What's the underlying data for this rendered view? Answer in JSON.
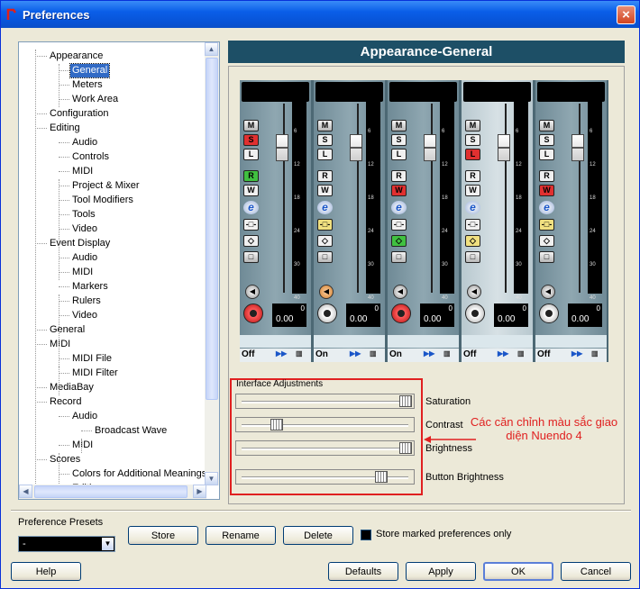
{
  "window": {
    "title": "Preferences",
    "close_icon": "×"
  },
  "tree": {
    "items": [
      {
        "label": "Appearance",
        "level": 1
      },
      {
        "label": "General",
        "level": 2,
        "selected": true
      },
      {
        "label": "Meters",
        "level": 2
      },
      {
        "label": "Work Area",
        "level": 2
      },
      {
        "label": "Configuration",
        "level": 1
      },
      {
        "label": "Editing",
        "level": 1
      },
      {
        "label": "Audio",
        "level": 2
      },
      {
        "label": "Controls",
        "level": 2
      },
      {
        "label": "MIDI",
        "level": 2
      },
      {
        "label": "Project & Mixer",
        "level": 2
      },
      {
        "label": "Tool Modifiers",
        "level": 2
      },
      {
        "label": "Tools",
        "level": 2
      },
      {
        "label": "Video",
        "level": 2
      },
      {
        "label": "Event Display",
        "level": 1
      },
      {
        "label": "Audio",
        "level": 2
      },
      {
        "label": "MIDI",
        "level": 2
      },
      {
        "label": "Markers",
        "level": 2
      },
      {
        "label": "Rulers",
        "level": 2
      },
      {
        "label": "Video",
        "level": 2
      },
      {
        "label": "General",
        "level": 1
      },
      {
        "label": "MIDI",
        "level": 1
      },
      {
        "label": "MIDI File",
        "level": 2
      },
      {
        "label": "MIDI Filter",
        "level": 2
      },
      {
        "label": "MediaBay",
        "level": 1
      },
      {
        "label": "Record",
        "level": 1
      },
      {
        "label": "Audio",
        "level": 2
      },
      {
        "label": "Broadcast Wave",
        "level": 3
      },
      {
        "label": "MIDI",
        "level": 2
      },
      {
        "label": "Scores",
        "level": 1
      },
      {
        "label": "Colors for Additional Meanings",
        "level": 2
      },
      {
        "label": "Editing",
        "level": 2
      }
    ]
  },
  "panel": {
    "title": "Appearance-General"
  },
  "mixer": {
    "buttons": {
      "mute": "M",
      "solo": "S",
      "listen": "L",
      "read": "R",
      "write": "W",
      "edit": "e"
    },
    "scale": [
      "6",
      "12",
      "18",
      "24",
      "30",
      "40"
    ],
    "channels": [
      {
        "value": "0.00",
        "peak": "0",
        "state": "Off",
        "solo_color": "#e03030",
        "listen_color": "#f0f0f0",
        "write_color": "#f0f0f0",
        "insert_color": "#f0f0f0",
        "send_color": "#f0f0f0",
        "rec_active": true,
        "mon_active": false,
        "read_active": true,
        "write_active": true
      },
      {
        "value": "0.00",
        "peak": "0",
        "state": "On",
        "solo_color": "#f0f0f0",
        "listen_color": "#f0f0f0",
        "write_color": "#f0f0f0",
        "insert_color": "#f0e080",
        "send_color": "#f0f0f0",
        "rec_active": false,
        "mon_active": true,
        "read_active": false,
        "write_active": false
      },
      {
        "value": "0.00",
        "peak": "0",
        "state": "On",
        "solo_color": "#f0f0f0",
        "listen_color": "#f0f0f0",
        "write_color": "#e03030",
        "insert_color": "#f0f0f0",
        "send_color": "#40c040",
        "rec_active": true,
        "mon_active": false,
        "read_active": false,
        "write_active": true
      },
      {
        "value": "0.00",
        "peak": "0",
        "state": "Off",
        "solo_color": "#f0f0f0",
        "listen_color": "#e03030",
        "write_color": "#f0f0f0",
        "insert_color": "#f0f0f0",
        "send_color": "#f0e080",
        "rec_active": false,
        "mon_active": false,
        "read_active": false,
        "write_active": false
      },
      {
        "value": "0.00",
        "peak": "0",
        "state": "Off",
        "solo_color": "#f0f0f0",
        "listen_color": "#f0f0f0",
        "write_color": "#e03030",
        "insert_color": "#f0e080",
        "send_color": "#f0f0f0",
        "rec_active": false,
        "mon_active": false,
        "read_active": false,
        "write_active": true
      }
    ]
  },
  "adjustments": {
    "title": "Interface Adjustments",
    "sliders": [
      {
        "label": "Saturation",
        "value": 1.0
      },
      {
        "label": "Contrast",
        "value": 0.2
      },
      {
        "label": "Brightness",
        "value": 1.0
      },
      {
        "label": "Button Brightness",
        "value": 0.85
      }
    ]
  },
  "annotation": {
    "text": "Các căn chỉnh màu sắc giao diện Nuendo 4",
    "color": "#e02020"
  },
  "presets": {
    "label": "Preference Presets",
    "selected": "-",
    "store": "Store",
    "rename": "Rename",
    "delete": "Delete",
    "store_marked_label": "Store marked preferences only"
  },
  "footer": {
    "help": "Help",
    "defaults": "Defaults",
    "apply": "Apply",
    "ok": "OK",
    "cancel": "Cancel"
  }
}
